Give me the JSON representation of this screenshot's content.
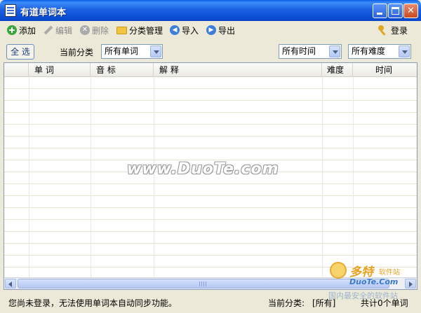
{
  "window": {
    "title": "有道单词本"
  },
  "toolbar": {
    "add": "添加",
    "edit": "编辑",
    "delete": "删除",
    "category": "分类管理",
    "import": "导入",
    "export": "导出",
    "login": "登录"
  },
  "filter": {
    "all_button": "全 选",
    "category_label": "当前分类",
    "category_value": "所有单词",
    "time_value": "所有时间",
    "difficulty_value": "所有难度"
  },
  "table": {
    "columns": [
      "单 词",
      "音 标",
      "解 释",
      "难度",
      "时间"
    ],
    "rows": []
  },
  "watermark": "www.DuoTe.com",
  "statusbar": {
    "message": "您尚未登录，无法使用单词本自动同步功能。",
    "category_label": "当前分类:",
    "category_value": "[所有]",
    "count": "共计0个单词"
  },
  "corner_logo": {
    "cn": "多特",
    "cn_sub": "软件站",
    "en": "DuoTe.Com",
    "site": "国内最安全的软件站"
  },
  "colors": {
    "titlebar": "#0a4fd6",
    "window_bg": "#ece9d8",
    "grid_line": "#e8e4cf"
  }
}
